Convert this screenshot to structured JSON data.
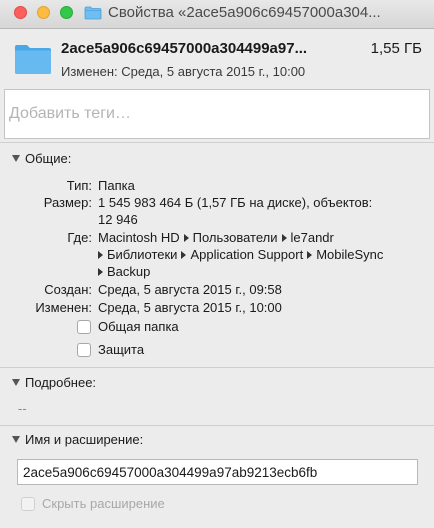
{
  "window": {
    "title": "Свойства «2ace5a906c69457000a304..."
  },
  "header": {
    "file_name": "2ace5a906c69457000a304499a97...",
    "size": "1,55 ГБ",
    "modified": "Изменен: Среда, 5 августа 2015 г., 10:00",
    "icon": "folder-icon"
  },
  "tags": {
    "placeholder": "Добавить теги…",
    "value": ""
  },
  "general": {
    "title": "Общие:",
    "type_label": "Тип:",
    "type_value": "Папка",
    "size_label": "Размер:",
    "size_value_line1": "1 545 983 464 Б (1,57 ГБ на диске), объектов:",
    "size_value_line2": "12 946",
    "where_label": "Где:",
    "where_path": [
      "Macintosh HD",
      "Пользователи",
      "le7andr",
      "Библиотеки",
      "Application Support",
      "MobileSync",
      "Backup"
    ],
    "created_label": "Создан:",
    "created_value": "Среда, 5 августа 2015 г., 09:58",
    "modified_label": "Изменен:",
    "modified_value": "Среда, 5 августа 2015 г., 10:00",
    "shared_folder_label": "Общая папка",
    "shared_folder_checked": false,
    "locked_label": "Защита",
    "locked_checked": false
  },
  "more_info": {
    "title": "Подробнее:",
    "value": "--"
  },
  "name_ext": {
    "title": "Имя и расширение:",
    "name_value": "2ace5a906c69457000a304499a97ab9213ecb6fb",
    "hide_ext_label": "Скрыть расширение",
    "hide_ext_checked": false
  },
  "colors": {
    "folder_blue": "#5fb4ee",
    "window_bg": "#ececec"
  }
}
